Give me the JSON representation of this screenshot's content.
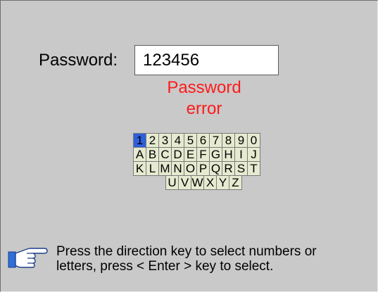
{
  "password": {
    "label": "Password:",
    "value": "123456",
    "error_line1": "Password",
    "error_line2": "error"
  },
  "keyboard": {
    "selected": "1",
    "rows": [
      [
        "1",
        "2",
        "3",
        "4",
        "5",
        "6",
        "7",
        "8",
        "9",
        "0"
      ],
      [
        "A",
        "B",
        "C",
        "D",
        "E",
        "F",
        "G",
        "H",
        "I",
        "J"
      ],
      [
        "K",
        "L",
        "M",
        "N",
        "O",
        "P",
        "Q",
        "R",
        "S",
        "T"
      ],
      [
        "U",
        "V",
        "W",
        "X",
        "Y",
        "Z"
      ]
    ]
  },
  "help": {
    "icon": "pointing-hand-icon",
    "line1": "Press the direction key to select numbers or",
    "line2": "letters, press < Enter > key to select."
  },
  "colors": {
    "error": "#ff1a1a",
    "selected_key": "#2f5fdc",
    "key_background": "#e6ead0",
    "screen_background": "#c9c9c9"
  }
}
